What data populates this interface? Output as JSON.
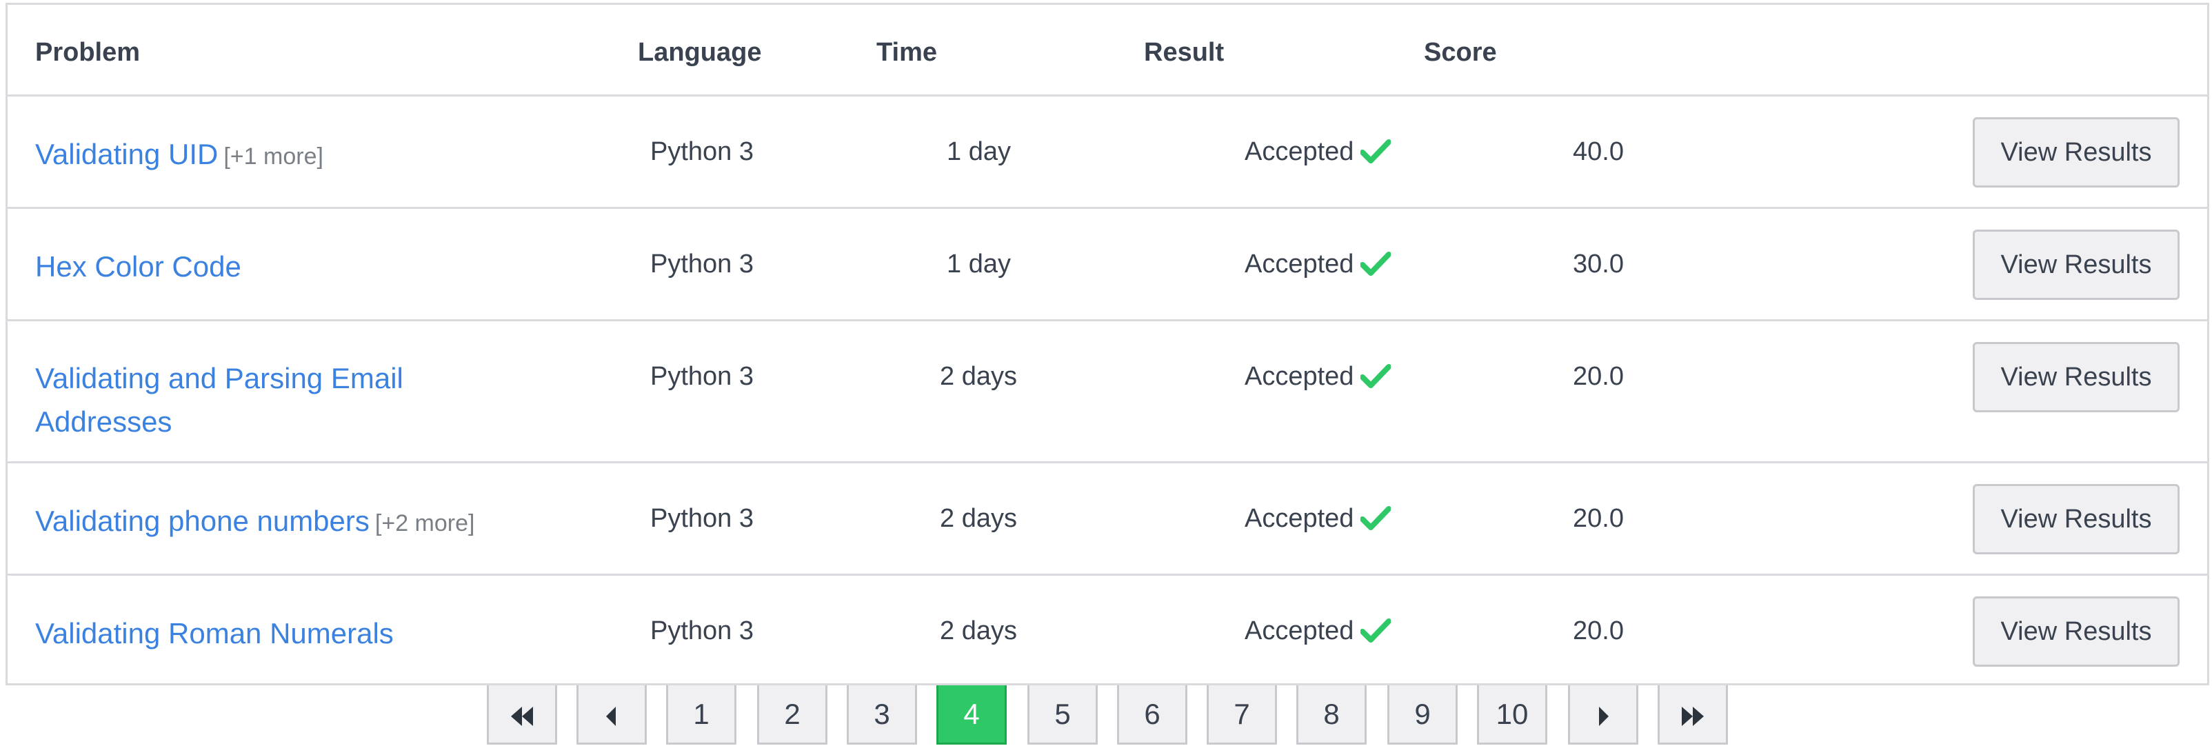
{
  "table": {
    "headers": {
      "problem": "Problem",
      "language": "Language",
      "time": "Time",
      "result": "Result",
      "score": "Score"
    },
    "rows": [
      {
        "problem": "Validating UID",
        "more": "[+1 more]",
        "language": "Python 3",
        "time": "1 day",
        "result": "Accepted",
        "score": "40.0",
        "button": "View Results"
      },
      {
        "problem": "Hex Color Code",
        "more": "",
        "language": "Python 3",
        "time": "1 day",
        "result": "Accepted",
        "score": "30.0",
        "button": "View Results"
      },
      {
        "problem": "Validating and Parsing Email Addresses",
        "more": "",
        "language": "Python 3",
        "time": "2 days",
        "result": "Accepted",
        "score": "20.0",
        "button": "View Results"
      },
      {
        "problem": "Validating phone numbers",
        "more": "[+2 more]",
        "language": "Python 3",
        "time": "2 days",
        "result": "Accepted",
        "score": "20.0",
        "button": "View Results"
      },
      {
        "problem": "Validating Roman Numerals",
        "more": "",
        "language": "Python 3",
        "time": "2 days",
        "result": "Accepted",
        "score": "20.0",
        "button": "View Results"
      }
    ]
  },
  "pagination": {
    "first_icon": "double-chevron-left-icon",
    "prev_icon": "triangle-left-icon",
    "pages": [
      "1",
      "2",
      "3",
      "4",
      "5",
      "6",
      "7",
      "8",
      "9",
      "10"
    ],
    "current": "4",
    "next_icon": "triangle-right-icon",
    "last_icon": "double-chevron-right-icon"
  },
  "colors": {
    "link": "#3b82e0",
    "accepted_check": "#2ec866",
    "active_page": "#2ec866",
    "text": "#39424e",
    "muted": "#7a7f86"
  }
}
